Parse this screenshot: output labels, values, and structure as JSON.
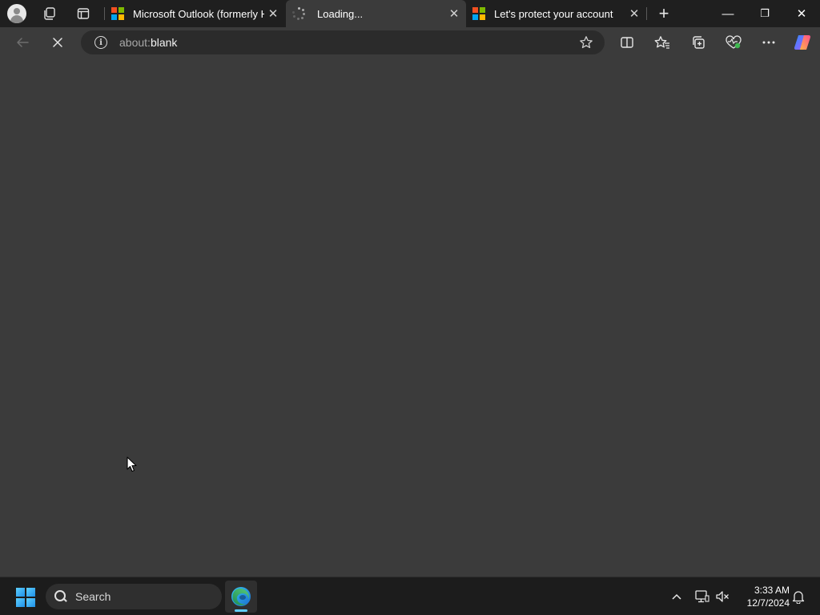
{
  "tabs": [
    {
      "label": "Microsoft Outlook (formerly Ho",
      "favicon": "microsoft-logo",
      "active": false
    },
    {
      "label": "Loading...",
      "favicon": "loading-spinner",
      "active": true
    },
    {
      "label": "Let's protect your account",
      "favicon": "microsoft-logo",
      "active": false
    }
  ],
  "tab_controls": {
    "close": "✕",
    "new_tab": "+"
  },
  "window_controls": {
    "minimize": "—",
    "restore": "❐",
    "close": "✕"
  },
  "address_bar": {
    "scheme": "about:",
    "host": "blank"
  },
  "toolbar_icons": [
    "back-arrow-icon",
    "stop-loading-icon",
    "site-info-icon",
    "favorite-star-icon",
    "split-screen-icon",
    "favorites-icon",
    "collections-icon",
    "browser-essentials-icon",
    "more-icon",
    "copilot-icon"
  ],
  "taskbar": {
    "search_placeholder": "Search",
    "time": "3:33 AM",
    "date": "12/7/2024"
  },
  "colors": {
    "page_bg": "#3b3b3b",
    "tabstrip_bg": "#1f1f1f",
    "taskbar_bg": "#1c1c1c",
    "accent": "#60cdff"
  }
}
